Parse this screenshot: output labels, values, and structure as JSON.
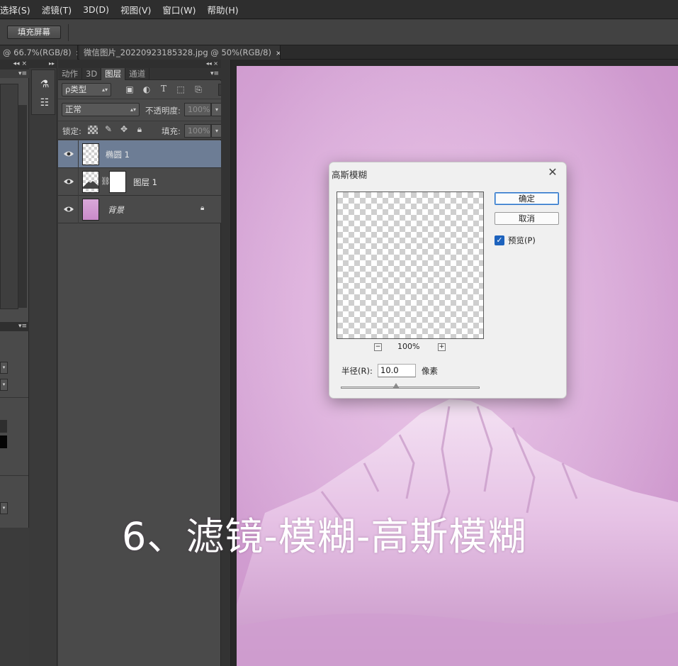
{
  "menubar": {
    "items": [
      "选择(S)",
      "滤镜(T)",
      "3D(D)",
      "视图(V)",
      "窗口(W)",
      "帮助(H)"
    ]
  },
  "options_bar": {
    "fill_screen_label": "填充屏幕"
  },
  "doc_tabs": [
    {
      "label": "@ 66.7%(RGB/8)",
      "close": "×"
    },
    {
      "label": "微信图片_20220923185328.jpg @ 50%(RGB/8)",
      "close": "×"
    }
  ],
  "panels": {
    "collapse_glyph": "◂◂",
    "close_glyph": "×",
    "menu_glyph": "▾≡",
    "expand_glyph": "▸▸"
  },
  "layers_panel": {
    "tabs": [
      "动作",
      "3D",
      "图层",
      "通道"
    ],
    "active_tab": "图层",
    "filter_label": "ρ类型",
    "blend_mode": "正常",
    "opacity_label": "不透明度:",
    "opacity_value": "100%",
    "lock_label": "锁定:",
    "fill_label": "填充:",
    "fill_value": "100%",
    "layers": [
      {
        "name": "椭圆 1",
        "selected": true
      },
      {
        "name": "图层 1",
        "selected": false
      },
      {
        "name": "背景",
        "selected": false,
        "locked": true
      }
    ]
  },
  "caption": "6、滤镜-模糊-高斯模糊",
  "dialog": {
    "title": "高斯模糊",
    "close": "✕",
    "ok_label": "确定",
    "cancel_label": "取消",
    "preview_label": "预览(P)",
    "preview_checked": true,
    "zoom_out": "−",
    "zoom_in": "+",
    "zoom_value": "100%",
    "radius_label": "半径(R):",
    "radius_value": "10.0",
    "radius_unit": "像素",
    "slider_fraction": 0.4
  },
  "colors": {
    "accent": "#1d62bd",
    "selected_layer": "#6d7d95",
    "canvas_pink": "#d6a6d6"
  }
}
